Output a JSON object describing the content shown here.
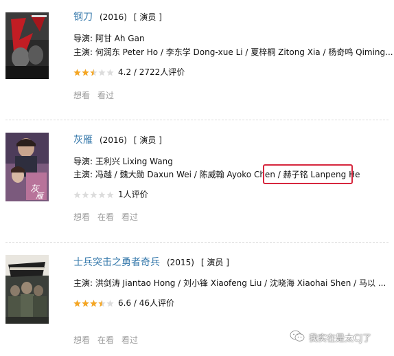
{
  "movies": [
    {
      "title": "钢刀",
      "year": "(2016)",
      "role": "[ 演员 ]",
      "director": "导演: 阿甘 Ah Gan",
      "cast": "主演: 何润东 Peter Ho / 李东学 Dong-xue Li / 夏梓桐 Zitong Xia / 杨奇鸣 Qiming...",
      "rating_score": "4.2",
      "rating_count": "2722人评价",
      "stars_out_of_5": 2.5,
      "actions": [
        "想看",
        "看过"
      ]
    },
    {
      "title": "灰雁",
      "year": "(2016)",
      "role": "[ 演员 ]",
      "director": "导演: 王利兴 Lixing Wang",
      "cast": "主演: 冯越 / 魏大勋 Daxun Wei / 陈威翰 Ayoko Chen / 赫子铭 Lanpeng He",
      "rating_count": "1人评价",
      "stars_out_of_5": 0,
      "actions": [
        "想看",
        "在看",
        "看过"
      ]
    },
    {
      "title": "士兵突击之勇者奇兵",
      "year": "(2015)",
      "role": "[ 演员 ]",
      "cast": "主演: 洪剑涛 Jiantao Hong / 刘小锋 Xiaofeng Liu / 沈晓海 Xiaohai Shen / 马以 ...",
      "rating_score": "6.6",
      "rating_count": "46人评价",
      "stars_out_of_5": 3.5,
      "actions": [
        "想看",
        "在看",
        "看过"
      ]
    }
  ],
  "watermark": "我实在是太CJ了",
  "colors": {
    "title_link": "#3377aa",
    "star_filled": "#f5a623",
    "star_empty": "#dcdcdc",
    "action_text": "#9b9b9b",
    "highlight_border": "#d6263d"
  }
}
